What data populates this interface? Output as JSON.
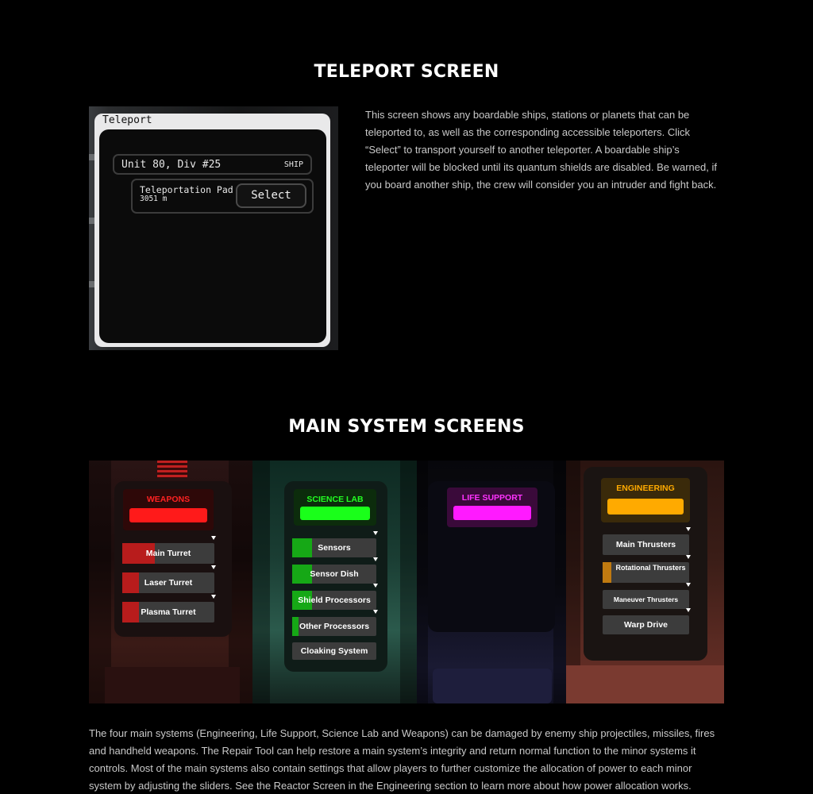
{
  "teleport": {
    "title": "TELEPORT SCREEN",
    "screen": {
      "window_title": "Teleport",
      "destination_name": "Unit 80, Div #25",
      "destination_type": "SHIP",
      "pad_name": "Teleportation Pad",
      "pad_distance": "3051 m",
      "select_label": "Select"
    },
    "description": "This screen shows any boardable ships, stations or planets that can be teleported to, as well as the corresponding accessible teleporters. Click “Select” to transport yourself to another teleporter. A boardable ship’s teleporter will be blocked until its quantum shields are disabled. Be warned, if you board another ship, the crew will consider you an intruder and fight back."
  },
  "main_systems": {
    "title": "MAIN SYSTEM SCREENS",
    "panels": {
      "weapons": {
        "label": "WEAPONS",
        "color": "#ff1a1a",
        "items": [
          {
            "label": "Main Turret",
            "level": 0.35
          },
          {
            "label": "Laser Turret",
            "level": 0.18
          },
          {
            "label": "Plasma Turret",
            "level": 0.18
          }
        ]
      },
      "science": {
        "label": "SCIENCE LAB",
        "color": "#1aff1a",
        "items": [
          {
            "label": "Sensors",
            "level": 0.24
          },
          {
            "label": "Sensor Dish",
            "level": 0.24
          },
          {
            "label": "Shield Processors",
            "level": 0.24
          },
          {
            "label": "Other Processors",
            "level": 0.08
          },
          {
            "label": "Cloaking System",
            "level": 0
          }
        ]
      },
      "life_support": {
        "label": "LIFE SUPPORT",
        "color": "#ff1aff"
      },
      "engineering": {
        "label": "ENGINEERING",
        "color": "#ffaa00",
        "items": [
          {
            "label": "Main Thrusters",
            "level": 0
          },
          {
            "label": "Rotational Thrusters",
            "level": 0.1
          },
          {
            "label": "Maneuver Thrusters",
            "level": 0
          },
          {
            "label": "Warp Drive",
            "level": 0
          }
        ]
      }
    },
    "description": "The four main systems (Engineering, Life Support, Science Lab and Weapons) can be damaged by enemy ship projectiles, missiles, fires and handheld weapons. The Repair Tool can help restore a main system’s integrity and return normal function to the minor systems it controls. Most of the main systems also contain settings that allow players to further customize the allocation of power to each minor system by adjusting the sliders. See the Reactor Screen in the Engineering section to learn more about how power allocation works."
  }
}
